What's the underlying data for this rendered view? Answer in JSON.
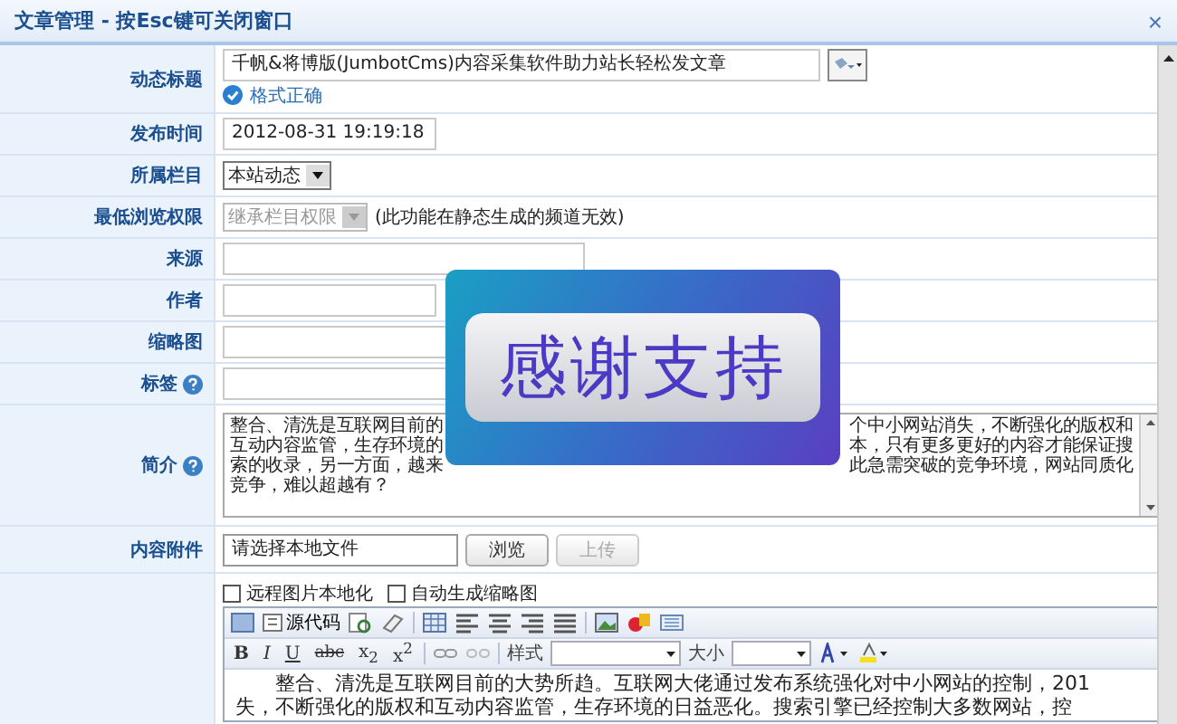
{
  "window": {
    "title": "文章管理 - 按Esc键可关闭窗口",
    "close": "×"
  },
  "form": [
    {
      "kind": "title",
      "label": "动态标题",
      "value": "千帆&将博版(JumbotCms)内容采集软件助力站长轻松发文章",
      "status": "格式正确"
    },
    {
      "kind": "short",
      "label": "发布时间",
      "value": "2012-08-31 19:19:18"
    },
    {
      "kind": "select",
      "label": "所属栏目",
      "value": "本站动态",
      "disabled": false
    },
    {
      "kind": "select",
      "label": "最低浏览权限",
      "value": "继承栏目权限",
      "disabled": true,
      "note": "(此功能在静态生成的频道无效)"
    },
    {
      "kind": "long",
      "label": "来源"
    },
    {
      "kind": "short",
      "label": "作者"
    },
    {
      "kind": "long",
      "label": "缩略图"
    },
    {
      "kind": "long",
      "label": "标签",
      "help": true
    },
    {
      "kind": "textarea",
      "label": "简介",
      "help": true,
      "lines": [
        {
          "left": "整合、清洗是互联网目前的",
          "right": "个中小网站消失，不断强化的版权和"
        },
        {
          "left": "互动内容监管，生存环境的",
          "right": "本，只有更多更好的内容才能保证搜"
        },
        {
          "left": "索的收录，另一方面，越来",
          "right": "此急需突破的竞争环境，网站同质化"
        },
        {
          "left": "竞争，难以超越有？"
        }
      ]
    },
    {
      "kind": "upload",
      "label": "内容附件",
      "value": "请选择本地文件",
      "buttons": [
        {
          "label": "浏览",
          "disabled": false
        },
        {
          "label": "上传",
          "disabled": true
        }
      ]
    },
    {
      "kind": "editor",
      "options": [
        {
          "label": "远程图片本地化",
          "checked": false
        },
        {
          "label": "自动生成缩略图",
          "checked": false
        }
      ],
      "source_label": "源代码",
      "format_buttons": [
        "B",
        "I",
        "U",
        "abc",
        "x$_{2}$",
        "x$^{2}$"
      ],
      "style_label": "样式",
      "size_label": "大小",
      "content": [
        "整合、清洗是互联网目前的大势所趋。互联网大佬通过发布系统强化对中小网站的控制，201",
        "失，不断强化的版权和互动内容监管，生存环境的日益恶化。搜索引擎已经控制大多数网站，控"
      ]
    }
  ],
  "overlay": {
    "text": "感谢支持"
  }
}
